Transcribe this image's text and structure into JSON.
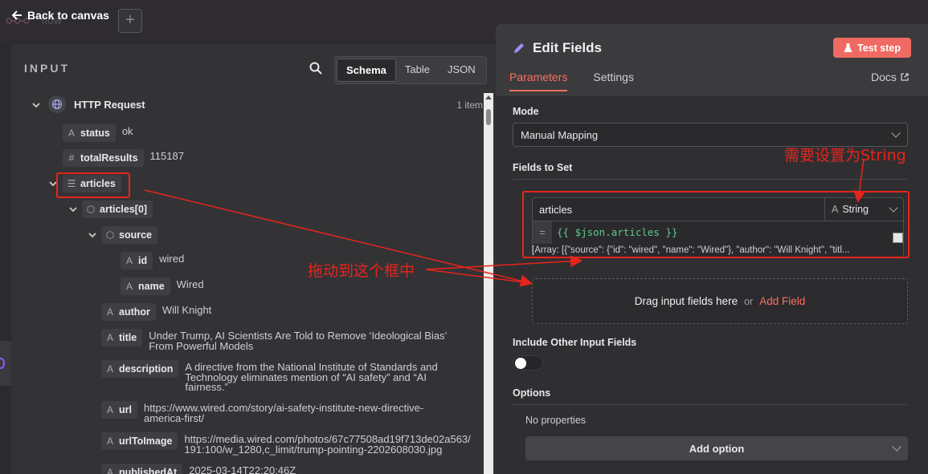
{
  "topbar": {
    "back_label": "Back to canvas",
    "ghost_text": "flow",
    "plus_label": "+"
  },
  "input_panel": {
    "title": "INPUT",
    "view_tabs": [
      "Schema",
      "Table",
      "JSON"
    ],
    "active_tab": "Schema",
    "node_name": "HTTP Request",
    "item_count": "1 item",
    "fields": [
      {
        "key": "status",
        "type_icon": "A",
        "value": "ok"
      },
      {
        "key": "totalResults",
        "type_icon": "#",
        "value": "115187"
      },
      {
        "key": "articles",
        "type_icon": "list"
      },
      {
        "key": "articles[0]",
        "type_icon": "cube"
      },
      {
        "key": "source",
        "type_icon": "cube"
      },
      {
        "key": "id",
        "type_icon": "A",
        "value": "wired"
      },
      {
        "key": "name",
        "type_icon": "A",
        "value": "Wired"
      },
      {
        "key": "author",
        "type_icon": "A",
        "value": "Will Knight"
      },
      {
        "key": "title",
        "type_icon": "A",
        "value": "Under Trump, AI Scientists Are Told to Remove ‘Ideological Bias’ From Powerful Models"
      },
      {
        "key": "description",
        "type_icon": "A",
        "value": "A directive from the National Institute of Standards and Technology eliminates mention of “AI safety” and “AI fairness.”"
      },
      {
        "key": "url",
        "type_icon": "A",
        "value": "https://www.wired.com/story/ai-safety-institute-new-directive-america-first/"
      },
      {
        "key": "urlToImage",
        "type_icon": "A",
        "value": "https://media.wired.com/photos/67c77508ad19f713de02a563/191:100/w_1280,c_limit/trump-pointing-2202608030.jpg"
      },
      {
        "key": "publishedAt",
        "type_icon": "A",
        "value": "2025-03-14T22:20:46Z"
      }
    ]
  },
  "edit_panel": {
    "title": "Edit Fields",
    "test_button": "Test step",
    "tabs": [
      "Parameters",
      "Settings"
    ],
    "active_tab": "Parameters",
    "docs_label": "Docs",
    "mode_label": "Mode",
    "mode_value": "Manual Mapping",
    "fields_to_set_label": "Fields to Set",
    "field_name": "articles",
    "field_type": "String",
    "field_expression": "{{ $json.articles }}",
    "field_preview": "[Array: [{\"source\": {\"id\": \"wired\", \"name\": \"Wired\"}, \"author\": \"Will Knight\", \"titl...",
    "drop_text": "Drag input fields here",
    "drop_or": "or",
    "drop_add": "Add Field",
    "include_label": "Include Other Input Fields",
    "options_label": "Options",
    "no_properties": "No properties",
    "add_option": "Add option"
  },
  "annotations": {
    "drag_hint": "拖动到这个框中",
    "type_hint": "需要设置为String"
  },
  "colors": {
    "accent": "#ff6f5c",
    "annotation_red": "#e8241a",
    "expr_green": "#5fc98a"
  }
}
